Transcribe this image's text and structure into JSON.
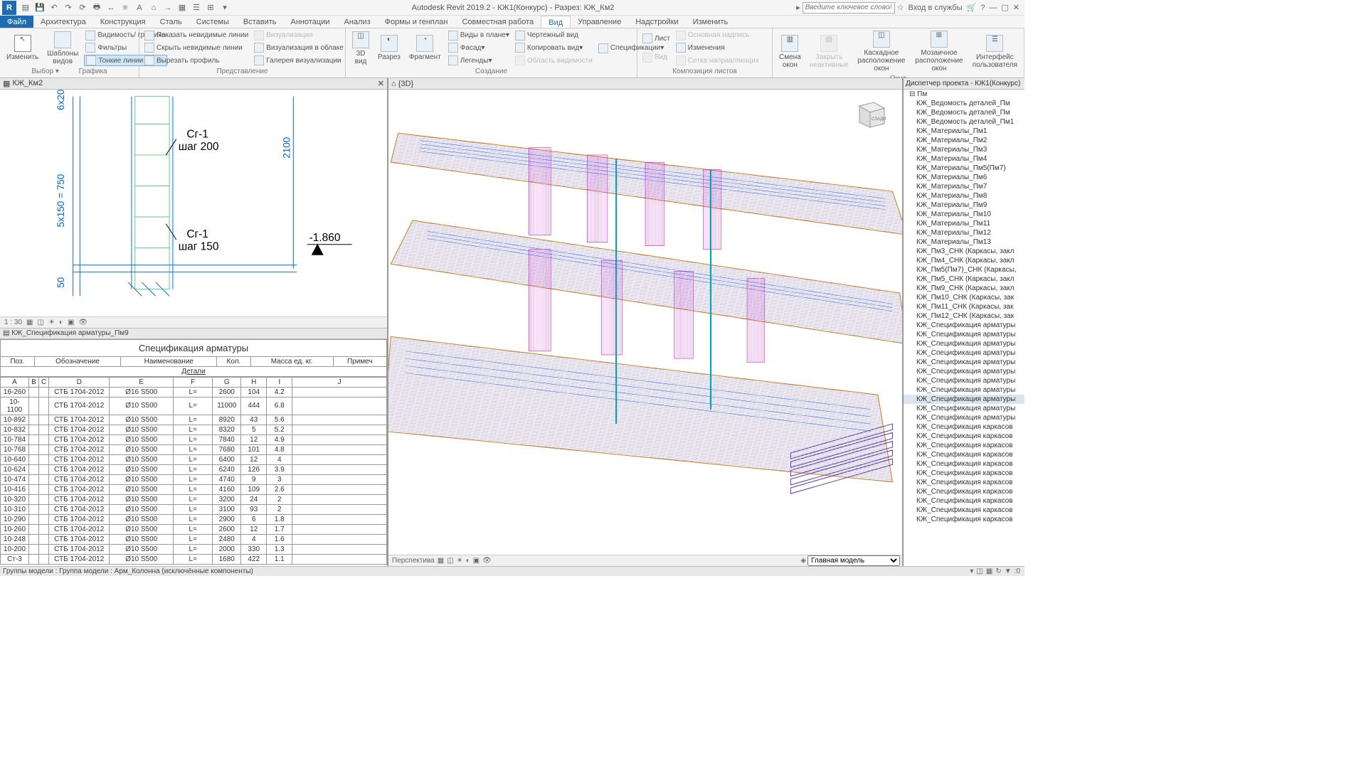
{
  "title": "Autodesk Revit 2019.2 - КЖ1(Конкурс) - Разрез: КЖ_Км2",
  "search_placeholder": "Введите ключевое слово/фразу",
  "signin": "Вход в службы",
  "tabs": [
    "Файл",
    "Архитектура",
    "Конструкция",
    "Сталь",
    "Системы",
    "Вставить",
    "Аннотации",
    "Анализ",
    "Формы и генплан",
    "Совместная работа",
    "Вид",
    "Управление",
    "Надстройки",
    "Изменить"
  ],
  "active_tab": 10,
  "panels": {
    "select": {
      "label": "Выбор",
      "modify": "Изменить",
      "templates": "Шаблоны\nвидов",
      "visibility": "Видимость/ графика",
      "filters": "Фильтры",
      "thin": "Тонкие линии"
    },
    "graphics": {
      "label": "Графика",
      "show": "Показать невидимые линии",
      "remove": "Скрыть невидимые линии",
      "cut": "Вырезать профиль",
      "render": "Визуализация",
      "cloud": "Визуализация  в облаке",
      "gallery": "Галерея  визуализации"
    },
    "present": {
      "label": "Представление"
    },
    "create": {
      "label": "Создание",
      "d3": "3D\nвид",
      "section": "Разрез",
      "callout": "Фрагмент",
      "plan": "Виды в плане",
      "elev": "Фасад",
      "legend": "Легенды",
      "draft": "Чертежный вид",
      "dup": "Копировать вид",
      "spec": "Спецификации",
      "scope": "Область видимости"
    },
    "sheets": {
      "label": "Композиция листов",
      "sheet": "Лист",
      "view": "Вид",
      "title": "Основная надпись",
      "rev": "Изменения",
      "guide": "Сетка направляющих"
    },
    "windows": {
      "label": "Окна",
      "switch": "Смена\nокон",
      "close": "Закрыть\nнеактивные",
      "cascade": "Каскадное\nрасположение окон",
      "tile": "Мозаичное\nрасположение окон",
      "ui": "Интерфейс\nпользователя"
    }
  },
  "view_left": "КЖ_Км2",
  "view_3d": "{3D}",
  "scale": "1 : 30",
  "sched_name": "КЖ_Спецификация арматуры_Пм9",
  "sched_title": "Спецификация арматуры",
  "sched_headers": [
    "Поз.",
    "Обозначение",
    "Наименование",
    "Кол.",
    "Масса ед. кг.",
    "Примеч"
  ],
  "sched_subtitle": "Детали",
  "sched_cols": [
    "A",
    "B",
    "C",
    "D",
    "E",
    "F",
    "G",
    "H",
    "I",
    "J"
  ],
  "rows": [
    [
      "16-260",
      "",
      "",
      "СТБ 1704-2012",
      "Ø16 S500",
      "L=",
      "2600",
      "104",
      "4.2",
      ""
    ],
    [
      "10-1100",
      "",
      "",
      "СТБ 1704-2012",
      "Ø10 S500",
      "L=",
      "11000",
      "444",
      "6.8",
      ""
    ],
    [
      "10-892",
      "",
      "",
      "СТБ 1704-2012",
      "Ø10 S500",
      "L=",
      "8920",
      "43",
      "5.6",
      ""
    ],
    [
      "10-832",
      "",
      "",
      "СТБ 1704-2012",
      "Ø10 S500",
      "L=",
      "8320",
      "5",
      "5.2",
      ""
    ],
    [
      "10-784",
      "",
      "",
      "СТБ 1704-2012",
      "Ø10 S500",
      "L=",
      "7840",
      "12",
      "4.9",
      ""
    ],
    [
      "10-768",
      "",
      "",
      "СТБ 1704-2012",
      "Ø10 S500",
      "L=",
      "7680",
      "101",
      "4.8",
      ""
    ],
    [
      "10-640",
      "",
      "",
      "СТБ 1704-2012",
      "Ø10 S500",
      "L=",
      "6400",
      "12",
      "4",
      ""
    ],
    [
      "10-624",
      "",
      "",
      "СТБ 1704-2012",
      "Ø10 S500",
      "L=",
      "6240",
      "126",
      "3.9",
      ""
    ],
    [
      "10-474",
      "",
      "",
      "СТБ 1704-2012",
      "Ø10 S500",
      "L=",
      "4740",
      "9",
      "3",
      ""
    ],
    [
      "10-416",
      "",
      "",
      "СТБ 1704-2012",
      "Ø10 S500",
      "L=",
      "4160",
      "109",
      "2.6",
      ""
    ],
    [
      "10-320",
      "",
      "",
      "СТБ 1704-2012",
      "Ø10 S500",
      "L=",
      "3200",
      "24",
      "2",
      ""
    ],
    [
      "10-310",
      "",
      "",
      "СТБ 1704-2012",
      "Ø10 S500",
      "L=",
      "3100",
      "93",
      "2",
      ""
    ],
    [
      "10-290",
      "",
      "",
      "СТБ 1704-2012",
      "Ø10 S500",
      "L=",
      "2900",
      "6",
      "1.8",
      ""
    ],
    [
      "10-260",
      "",
      "",
      "СТБ 1704-2012",
      "Ø10 S500",
      "L=",
      "2600",
      "12",
      "1.7",
      ""
    ],
    [
      "10-248",
      "",
      "",
      "СТБ 1704-2012",
      "Ø10 S500",
      "L=",
      "2480",
      "4",
      "1.6",
      ""
    ],
    [
      "10-200",
      "",
      "",
      "СТБ 1704-2012",
      "Ø10 S500",
      "L=",
      "2000",
      "330",
      "1.3",
      ""
    ],
    [
      "Ст-3",
      "",
      "",
      "СТБ 1704-2012",
      "Ø10 S500",
      "L=",
      "1680",
      "422",
      "1.1",
      ""
    ]
  ],
  "browser_title": "Диспетчер проекта - КЖ1(Конкурс)",
  "browser_parent": "Пм",
  "tree": [
    "КЖ_Ведомость деталей_Пм",
    "КЖ_Ведомость деталей_Пм",
    "КЖ_Ведомость деталей_Пм1",
    "КЖ_Материалы_Пм1",
    "КЖ_Материалы_Пм2",
    "КЖ_Материалы_Пм3",
    "КЖ_Материалы_Пм4",
    "КЖ_Материалы_Пм5(Пм7)",
    "КЖ_Материалы_Пм6",
    "КЖ_Материалы_Пм7",
    "КЖ_Материалы_Пм8",
    "КЖ_Материалы_Пм9",
    "КЖ_Материалы_Пм10",
    "КЖ_Материалы_Пм11",
    "КЖ_Материалы_Пм12",
    "КЖ_Материалы_Пм13",
    "КЖ_Пм3_СНК (Каркасы, закл",
    "КЖ_Пм4_СНК (Каркасы, закл",
    "КЖ_Пм5(Пм7)_СНК (Каркасы,",
    "КЖ_Пм5_СНК (Каркасы, закл",
    "КЖ_Пм9_СНК (Каркасы, закл",
    "КЖ_Пм10_СНК (Каркасы, зак",
    "КЖ_Пм11_СНК (Каркасы, зак",
    "КЖ_Пм12_СНК (Каркасы, зак",
    "КЖ_Спецификация арматуры",
    "КЖ_Спецификация арматуры",
    "КЖ_Спецификация арматуры",
    "КЖ_Спецификация арматуры",
    "КЖ_Спецификация арматуры",
    "КЖ_Спецификация арматуры",
    "КЖ_Спецификация арматуры",
    "КЖ_Спецификация арматуры",
    "КЖ_Спецификация арматуры",
    "КЖ_Спецификация арматуры",
    "КЖ_Спецификация арматуры",
    "КЖ_Спецификация каркасов",
    "КЖ_Спецификация каркасов",
    "КЖ_Спецификация каркасов",
    "КЖ_Спецификация каркасов",
    "КЖ_Спецификация каркасов",
    "КЖ_Спецификация каркасов",
    "КЖ_Спецификация каркасов",
    "КЖ_Спецификация каркасов",
    "КЖ_Спецификация каркасов",
    "КЖ_Спецификация каркасов",
    "КЖ_Спецификация каркасов"
  ],
  "tree_selected": 32,
  "persp": "Перспектива",
  "workset": "Главная модель",
  "status": "Группы модели : Группа модели : Арм_Колонна (исключённые компоненты)",
  "section": {
    "dim1": "6x20",
    "dim2": "5x150 = 750",
    "dim3": "50",
    "dim4": "2100",
    "lbl1": "Сг-1",
    "step1": "шаг 200",
    "lbl2": "Сг-1",
    "step2": "шаг 150",
    "elev": "-1.860"
  }
}
